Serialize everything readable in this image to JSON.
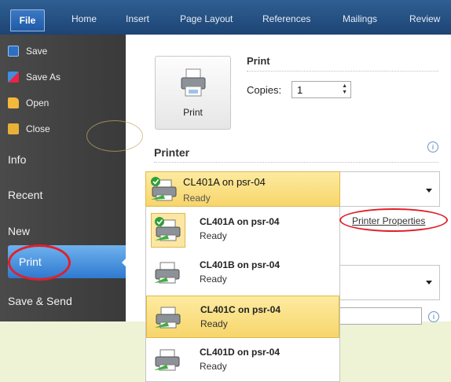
{
  "ribbon": {
    "tabs": [
      "File",
      "Home",
      "Insert",
      "Page Layout",
      "References",
      "Mailings",
      "Review"
    ]
  },
  "nav": {
    "save": "Save",
    "save_as": "Save As",
    "open": "Open",
    "close": "Close",
    "info": "Info",
    "recent": "Recent",
    "new": "New",
    "print": "Print",
    "save_send": "Save & Send"
  },
  "print_section": {
    "button_label": "Print",
    "heading": "Print",
    "copies_label": "Copies:",
    "copies_value": "1"
  },
  "printer_section": {
    "heading": "Printer",
    "info_icon": "i",
    "selected": {
      "name": "CL401A on psr-04",
      "status": "Ready"
    },
    "properties_link": "Printer Properties",
    "printers": [
      {
        "name": "CL401A on psr-04",
        "status": "Ready",
        "default": true
      },
      {
        "name": "CL401B on psr-04",
        "status": "Ready",
        "default": false
      },
      {
        "name": "CL401C on psr-04",
        "status": "Ready",
        "default": false
      },
      {
        "name": "CL401D on psr-04",
        "status": "Ready",
        "default": false
      }
    ]
  },
  "settings": {
    "info_icon": "i"
  },
  "colors": {
    "ribbon": "#1d4474",
    "nav_bg": "#3f3f3f",
    "print_selected": "#3e86d8",
    "highlight": "#f9dc78",
    "annotation_red": "#e0202a"
  }
}
